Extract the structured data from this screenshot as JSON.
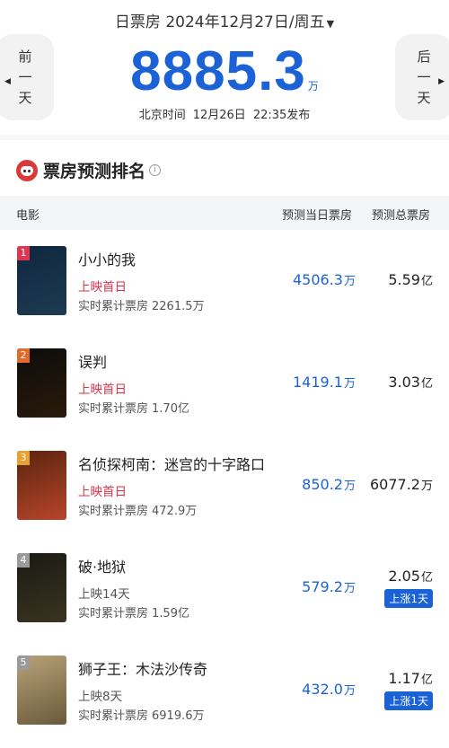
{
  "header": {
    "date_label": "日票房 2024年12月27日/周五",
    "prev": [
      "前",
      "一",
      "天"
    ],
    "next": [
      "后",
      "一",
      "天"
    ],
    "total_value": "8885.3",
    "total_unit": "万",
    "pub_zone": "北京时间",
    "pub_date": "12月26日",
    "pub_time": "22:35发布"
  },
  "section": {
    "title": "票房预测排名",
    "columns": {
      "movie": "电影",
      "daily": "预测当日票房",
      "total": "预测总票房"
    }
  },
  "movies": [
    {
      "rank": "1",
      "title": "小小的我",
      "status": "上映首日",
      "status_color": "#d9304a",
      "cum_label": "实时累计票房",
      "cum_value": "2261.5万",
      "daily_value": "4506.3",
      "daily_unit": "万",
      "total_value": "5.59",
      "total_unit": "亿",
      "badge": "",
      "rank_color": "#e0364f",
      "poster_text": "",
      "poster_colors": [
        "#0f2740",
        "#1d3b52"
      ]
    },
    {
      "rank": "2",
      "title": "误判",
      "status": "上映首日",
      "status_color": "#d9304a",
      "cum_label": "实时累计票房",
      "cum_value": "1.70亿",
      "daily_value": "1419.1",
      "daily_unit": "万",
      "total_value": "3.03",
      "total_unit": "亿",
      "badge": "",
      "rank_color": "#e46a2a",
      "poster_text": "",
      "poster_colors": [
        "#0c0c0c",
        "#2a1a0a"
      ]
    },
    {
      "rank": "3",
      "title": "名侦探柯南：迷宫的十字路口",
      "status": "上映首日",
      "status_color": "#d9304a",
      "cum_label": "实时累计票房",
      "cum_value": "472.9万",
      "daily_value": "850.2",
      "daily_unit": "万",
      "total_value": "6077.2",
      "total_unit": "万",
      "badge": "",
      "rank_color": "#e8a030",
      "poster_text": "",
      "poster_colors": [
        "#5a2410",
        "#b8452a"
      ]
    },
    {
      "rank": "4",
      "title": "破·地狱",
      "status": "上映14天",
      "status_color": "#555555",
      "cum_label": "实时累计票房",
      "cum_value": "1.59亿",
      "daily_value": "579.2",
      "daily_unit": "万",
      "total_value": "2.05",
      "total_unit": "亿",
      "badge": "上涨1天",
      "rank_color": "#9a9a9a",
      "poster_text": "",
      "poster_colors": [
        "#1a1a14",
        "#3a3420"
      ]
    },
    {
      "rank": "5",
      "title": "狮子王：木法沙传奇",
      "status": "上映8天",
      "status_color": "#555555",
      "cum_label": "实时累计票房",
      "cum_value": "6919.6万",
      "daily_value": "432.0",
      "daily_unit": "万",
      "total_value": "1.17",
      "total_unit": "亿",
      "badge": "上涨1天",
      "rank_color": "#9a9a9a",
      "poster_text": "",
      "poster_colors": [
        "#b8a27a",
        "#6a5a3a"
      ]
    }
  ]
}
